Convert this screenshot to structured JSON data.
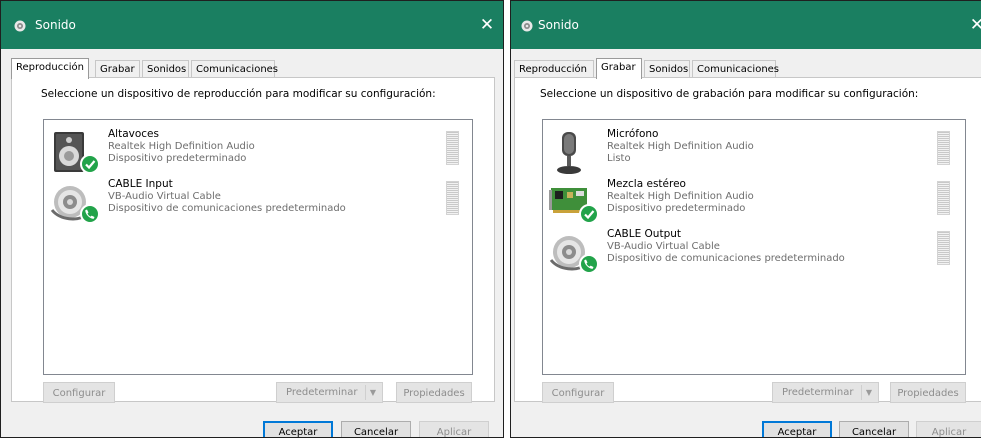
{
  "colors": {
    "titlebar": "#1a7f61",
    "default_button_border": "#0078d7",
    "check_badge": "#22a34a"
  },
  "left": {
    "window_title": "Sonido",
    "close_icon": "✕",
    "tabs": [
      "Reproducción",
      "Grabar",
      "Sonidos",
      "Comunicaciones"
    ],
    "active_tab": "Reproducción",
    "instruction": "Seleccione un dispositivo de reproducción para modificar su configuración:",
    "devices": [
      {
        "name": "Altavoces",
        "line1": "Realtek High Definition Audio",
        "line2": "Dispositivo predeterminado",
        "icon": "speaker-icon",
        "badge": "check-icon"
      },
      {
        "name": "CABLE Input",
        "line1": "VB-Audio Virtual Cable",
        "line2": "Dispositivo de comunicaciones predeterminado",
        "icon": "virtual-cable-icon",
        "badge": "phone-icon"
      }
    ],
    "buttons": {
      "configure": "Configurar",
      "set_default": "Predeterminar",
      "properties": "Propiedades",
      "ok": "Aceptar",
      "cancel": "Cancelar",
      "apply": "Aplicar"
    }
  },
  "right": {
    "window_title": "Sonido",
    "close_icon": "✕",
    "tabs": [
      "Reproducción",
      "Grabar",
      "Sonidos",
      "Comunicaciones"
    ],
    "active_tab": "Grabar",
    "instruction": "Seleccione un dispositivo de grabación para modificar su configuración:",
    "devices": [
      {
        "name": "Micrófono",
        "line1": "Realtek High Definition Audio",
        "line2": "Listo",
        "icon": "microphone-icon",
        "badge": ""
      },
      {
        "name": "Mezcla estéreo",
        "line1": "Realtek High Definition Audio",
        "line2": "Dispositivo predeterminado",
        "icon": "sound-card-icon",
        "badge": "check-icon"
      },
      {
        "name": "CABLE Output",
        "line1": "VB-Audio Virtual Cable",
        "line2": "Dispositivo de comunicaciones predeterminado",
        "icon": "virtual-cable-icon",
        "badge": "phone-icon"
      }
    ],
    "buttons": {
      "configure": "Configurar",
      "set_default": "Predeterminar",
      "properties": "Propiedades",
      "ok": "Aceptar",
      "cancel": "Cancelar",
      "apply": "Aplicar"
    }
  }
}
